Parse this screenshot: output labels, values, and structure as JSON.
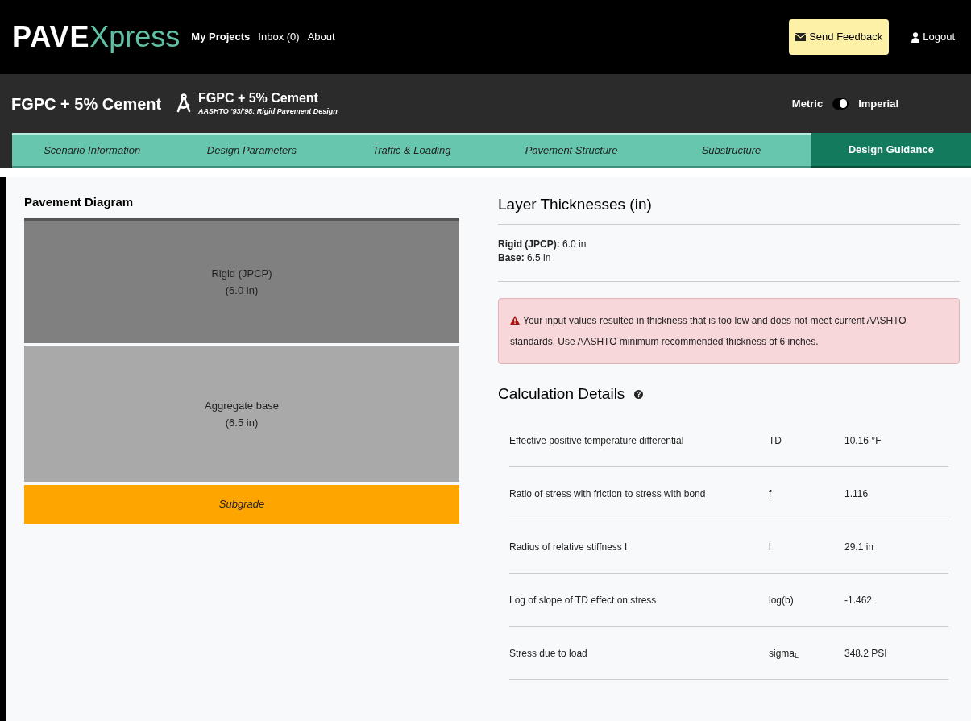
{
  "navbar": {
    "brand_bold": "PAVE",
    "brand_light": "Xpress",
    "links": [
      "My Projects",
      "Inbox (0)",
      "About"
    ],
    "feedback_button": "Send Feedback",
    "logout": "Logout"
  },
  "header": {
    "project_title": "FGPC + 5% Cement",
    "scenario_title": "FGPC + 5% Cement",
    "scenario_subtitle": "AASHTO '93/'98: Rigid Pavement Design",
    "unit_options": [
      {
        "label": "Metric",
        "selected": false
      },
      {
        "label": "Imperial",
        "selected": true
      }
    ]
  },
  "tabs": [
    {
      "label": "Scenario Information",
      "selected": false
    },
    {
      "label": "Design Parameters",
      "selected": false
    },
    {
      "label": "Traffic & Loading",
      "selected": false
    },
    {
      "label": "Pavement Structure",
      "selected": false
    },
    {
      "label": "Substructure",
      "selected": false
    },
    {
      "label": "Design Guidance",
      "selected": true
    }
  ],
  "pavement_diagram": {
    "title": "Pavement Diagram",
    "layers": [
      {
        "kind": "rigid",
        "name": "Rigid (JPCP)",
        "thickness": "(6.0 in)",
        "color": "#808080"
      },
      {
        "kind": "base",
        "name": "Aggregate base",
        "thickness": "(6.5 in)",
        "color": "#a9a9a9"
      },
      {
        "kind": "subgrade",
        "name": "Subgrade",
        "color": "#ffa500"
      }
    ]
  },
  "layer_thicknesses": {
    "title": "Layer Thicknesses (in)",
    "items": [
      {
        "label": "Rigid (JPCP):",
        "value": "6.0 in"
      },
      {
        "label": "Base:",
        "value": "6.5 in"
      }
    ]
  },
  "alert": "Your input values resulted in thickness that is too low and does not meet current AASHTO standards. Use AASHTO minimum recommended thickness of 6 inches.",
  "calculation_details": {
    "title": "Calculation Details",
    "rows": [
      {
        "description": "Effective positive temperature differential",
        "symbol": "TD",
        "value": "10.16 °F"
      },
      {
        "description": "Ratio of stress with friction to stress with bond",
        "symbol": "f",
        "value": "1.116"
      },
      {
        "description": "Radius of relative stiffness l",
        "symbol": "l",
        "value": "29.1 in"
      },
      {
        "description": "Log of slope of TD effect on stress",
        "symbol": "log(b)",
        "value": "-1.462"
      },
      {
        "description": "Stress due to load",
        "symbol": "sigma$_{L}$",
        "value": "348.2 PSI"
      }
    ]
  }
}
